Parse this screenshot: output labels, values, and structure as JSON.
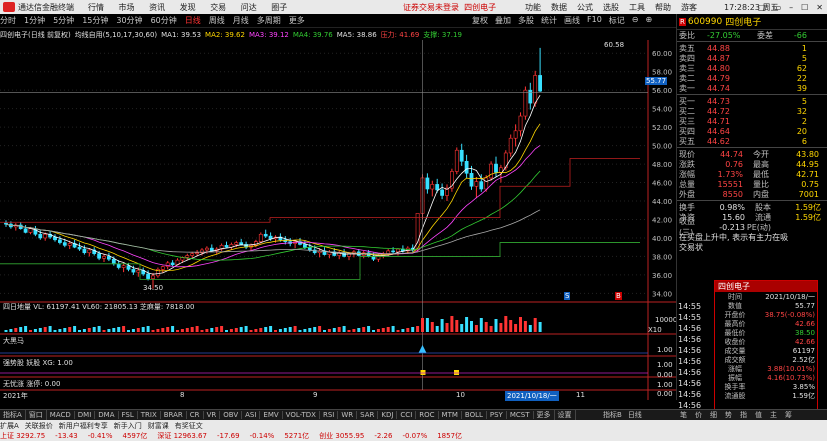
{
  "app": {
    "name": "通达信金融终端",
    "menu": [
      "行情",
      "市场",
      "资讯",
      "发现",
      "交易",
      "问达",
      "圈子"
    ],
    "notice": "证券交易未登录",
    "stock_title": "四创电子",
    "right_menu": [
      "功能",
      "数据",
      "公式",
      "选股",
      "工具",
      "帮助",
      "游客"
    ],
    "time": "17:28:23 周五",
    "window_controls": [
      "□",
      "▭",
      "–",
      "☐",
      "✕"
    ]
  },
  "periods": [
    "分时",
    "1分钟",
    "5分钟",
    "15分钟",
    "30分钟",
    "60分钟",
    "日线",
    "周线",
    "月线",
    "多周期",
    "更多"
  ],
  "active_period": "日线",
  "tools": [
    "复权",
    "叠加",
    "多股",
    "统计",
    "画线",
    "F10",
    "标记",
    "⊖",
    "⊕"
  ],
  "indicator_header": {
    "stock": "四创电子(日线 前复权)",
    "indicator": "均线自用(5,10,17,30,60)",
    "ma1": "MA1: 39.53",
    "ma2": "MA2: 39.62",
    "ma3": "MA3: 39.12",
    "ma4": "MA4: 39.76",
    "ma5": "MA5: 38.86",
    "pressure": "压力: 41.69",
    "support": "支撑: 37.19"
  },
  "price_axis": [
    "60.00",
    "58.00",
    "56.00",
    "54.00",
    "52.00",
    "50.00",
    "48.00",
    "46.00",
    "44.00",
    "42.00",
    "40.00",
    "38.00",
    "36.00",
    "34.00"
  ],
  "chart_labels": {
    "high": "60.58",
    "low": "34.50",
    "cursor_price": "55.77",
    "vol_line": "四日地量 VL: 61197.41 VL60: 21805.13 芝麻量: 7818.00",
    "vol_axis": [
      "10000",
      "X10"
    ],
    "ind2": "大黑马",
    "ind2_axis": "1.00",
    "ind3": "强势股 妖股 XG: 1.00",
    "ind3_axis": [
      "1.00",
      "0.00"
    ],
    "ind4": "无忧涨 涨停: 0.00",
    "ind4_axis": [
      "1.00",
      "0.00"
    ],
    "date_left": "2021年",
    "date_cursor": "2021/10/18/一",
    "month_labels": [
      "8",
      "9",
      "10",
      "11"
    ],
    "mark_s": "S",
    "mark_b": "B"
  },
  "panel": {
    "code": "600990",
    "name": "四创电子",
    "weibi_label": "委比",
    "weibi": "-27.05%",
    "weicha_label": "委差",
    "weicha": "-66",
    "asks": [
      {
        "label": "卖五",
        "price": "44.88",
        "vol": "1"
      },
      {
        "label": "卖四",
        "price": "44.87",
        "vol": "5"
      },
      {
        "label": "卖三",
        "price": "44.80",
        "vol": "62"
      },
      {
        "label": "卖二",
        "price": "44.79",
        "vol": "22"
      },
      {
        "label": "卖一",
        "price": "44.74",
        "vol": "39"
      }
    ],
    "bids": [
      {
        "label": "买一",
        "price": "44.73",
        "vol": "5"
      },
      {
        "label": "买二",
        "price": "44.72",
        "vol": "32"
      },
      {
        "label": "买三",
        "price": "44.71",
        "vol": "2"
      },
      {
        "label": "买四",
        "price": "44.64",
        "vol": "20"
      },
      {
        "label": "买五",
        "price": "44.62",
        "vol": "6"
      }
    ],
    "stats": [
      {
        "l1": "现价",
        "v1": "44.74",
        "l2": "今开",
        "v2": "43.80"
      },
      {
        "l1": "涨跌",
        "v1": "0.76",
        "l2": "最高",
        "v2": "44.95"
      },
      {
        "l1": "涨幅",
        "v1": "1.73%",
        "l2": "最低",
        "v2": "42.71"
      },
      {
        "l1": "总量",
        "v1": "15551",
        "l2": "量比",
        "v2": "0.75"
      },
      {
        "l1": "外盘",
        "v1": "8550",
        "l2": "内盘",
        "v2": "7001"
      }
    ],
    "stats2": [
      {
        "l1": "换手",
        "v1": "0.98%",
        "l2": "股本",
        "v2": "1.59亿"
      },
      {
        "l1": "净资",
        "v1": "15.60",
        "l2": "流通",
        "v2": "1.59亿"
      },
      {
        "l1": "收益(三)",
        "v1": "-0.213",
        "l2": "PE(动)",
        "v2": ""
      }
    ],
    "note1": "在买盘上升中, 表示有主力在吸",
    "note2": "交易状"
  },
  "ticks": [
    "14:55",
    "14:55",
    "14:56",
    "14:56",
    "14:56",
    "14:56",
    "14:56",
    "14:56",
    "14:56",
    "14:56"
  ],
  "popup": {
    "title": "四创电子",
    "rows": [
      {
        "label": "时间",
        "value": "2021/10/18/一"
      },
      {
        "label": "数值",
        "value": "55.77"
      },
      {
        "label": "开盘价",
        "value": "38.75(-0.08%)"
      },
      {
        "label": "最高价",
        "value": "42.66"
      },
      {
        "label": "最低价",
        "value": "38.50"
      },
      {
        "label": "收盘价",
        "value": "42.66"
      },
      {
        "label": "成交量",
        "value": "61197"
      },
      {
        "label": "成交额",
        "value": "2.52亿"
      },
      {
        "label": "涨幅",
        "value": "3.88(10.01%)"
      },
      {
        "label": "振幅",
        "value": "4.16(10.73%)"
      },
      {
        "label": "换手率",
        "value": "3.85%"
      },
      {
        "label": "流通股",
        "value": "1.59亿"
      }
    ]
  },
  "tabs": [
    "指标A",
    "窗口",
    "MACD",
    "DMI",
    "DMA",
    "FSL",
    "TRIX",
    "BRAR",
    "CR",
    "VR",
    "OBV",
    "ASI",
    "EMV",
    "VOL-TDX",
    "RSI",
    "WR",
    "SAR",
    "KDJ",
    "CCI",
    "ROC",
    "MTM",
    "BOLL",
    "PSY",
    "MCST",
    "更多",
    "设置"
  ],
  "tabs_right": [
    "指标B",
    "日线"
  ],
  "right_bottom": [
    "笔",
    "价",
    "细",
    "势",
    "指",
    "值",
    "主",
    "筹"
  ],
  "status": [
    "扩展A",
    "关联报价",
    "新用户福利专享",
    "新手入门",
    "财富课",
    "有奖征文"
  ],
  "ticker": [
    "上证 3292.75",
    "-13.43",
    "-0.41%",
    "4597亿",
    "深证 12963.67",
    "-17.69",
    "-0.14%",
    "5271亿",
    "创业 3055.95",
    "-2.26",
    "-0.07%",
    "1857亿"
  ],
  "chart_data": {
    "type": "candlestick",
    "ylim": [
      33.5,
      61.0
    ],
    "candles": [
      [
        41.6,
        41.9,
        41.2,
        41.5
      ],
      [
        41.5,
        41.8,
        41.0,
        41.2
      ],
      [
        41.2,
        41.6,
        40.8,
        41.4
      ],
      [
        41.4,
        41.7,
        40.9,
        41.0
      ],
      [
        41.0,
        41.4,
        40.5,
        40.6
      ],
      [
        40.6,
        41.2,
        40.4,
        41.0
      ],
      [
        41.0,
        41.3,
        40.2,
        40.4
      ],
      [
        40.4,
        40.8,
        39.8,
        40.0
      ],
      [
        40.0,
        40.6,
        39.7,
        40.4
      ],
      [
        40.4,
        40.7,
        39.9,
        40.1
      ],
      [
        40.1,
        40.4,
        39.6,
        39.8
      ],
      [
        39.8,
        40.2,
        39.3,
        39.5
      ],
      [
        39.5,
        39.9,
        39.0,
        39.2
      ],
      [
        39.2,
        39.7,
        38.8,
        39.4
      ],
      [
        39.4,
        39.8,
        38.9,
        39.0
      ],
      [
        39.0,
        39.5,
        38.6,
        38.8
      ],
      [
        38.8,
        39.2,
        38.2,
        38.4
      ],
      [
        38.4,
        38.9,
        38.0,
        38.7
      ],
      [
        38.7,
        39.0,
        38.1,
        38.3
      ],
      [
        38.3,
        38.6,
        37.6,
        37.8
      ],
      [
        37.8,
        38.3,
        37.4,
        38.0
      ],
      [
        38.0,
        38.4,
        37.5,
        37.7
      ],
      [
        37.7,
        38.0,
        37.0,
        37.2
      ],
      [
        37.2,
        37.6,
        36.6,
        36.8
      ],
      [
        36.8,
        37.3,
        36.3,
        37.0
      ],
      [
        37.0,
        37.3,
        36.4,
        36.6
      ],
      [
        36.6,
        37.0,
        36.0,
        36.3
      ],
      [
        36.3,
        36.8,
        35.8,
        36.5
      ],
      [
        36.5,
        36.8,
        35.9,
        36.1
      ],
      [
        36.1,
        36.5,
        35.4,
        35.6
      ],
      [
        35.6,
        36.2,
        34.5,
        35.9
      ],
      [
        35.9,
        36.8,
        35.7,
        36.6
      ],
      [
        36.6,
        37.0,
        36.2,
        36.9
      ],
      [
        36.9,
        37.5,
        36.6,
        37.3
      ],
      [
        37.3,
        37.6,
        36.9,
        37.1
      ],
      [
        37.1,
        37.8,
        37.0,
        37.6
      ],
      [
        37.6,
        38.0,
        37.3,
        37.9
      ],
      [
        37.9,
        38.3,
        37.6,
        38.1
      ],
      [
        38.1,
        38.5,
        37.8,
        38.3
      ],
      [
        38.3,
        38.7,
        38.0,
        38.4
      ],
      [
        38.4,
        38.9,
        38.1,
        38.7
      ],
      [
        38.7,
        39.1,
        38.3,
        38.9
      ],
      [
        38.9,
        39.3,
        38.5,
        38.6
      ],
      [
        38.6,
        39.0,
        38.2,
        38.8
      ],
      [
        38.8,
        39.4,
        38.6,
        39.2
      ],
      [
        39.2,
        39.6,
        38.9,
        39.0
      ],
      [
        39.0,
        39.5,
        38.7,
        39.3
      ],
      [
        39.3,
        39.7,
        39.0,
        39.5
      ],
      [
        39.5,
        39.9,
        39.2,
        39.3
      ],
      [
        39.3,
        39.6,
        38.8,
        39.0
      ],
      [
        39.0,
        39.4,
        38.6,
        39.2
      ],
      [
        39.2,
        39.8,
        39.0,
        39.6
      ],
      [
        39.6,
        40.6,
        39.4,
        40.4
      ],
      [
        40.4,
        40.9,
        40.0,
        40.2
      ],
      [
        40.2,
        40.6,
        39.7,
        39.9
      ],
      [
        39.9,
        40.3,
        39.5,
        40.1
      ],
      [
        40.1,
        40.5,
        39.6,
        39.8
      ],
      [
        39.8,
        40.2,
        39.3,
        39.6
      ],
      [
        39.6,
        40.0,
        39.1,
        39.4
      ],
      [
        39.4,
        39.8,
        38.9,
        39.6
      ],
      [
        39.6,
        40.0,
        39.2,
        39.3
      ],
      [
        39.3,
        39.7,
        38.8,
        39.0
      ],
      [
        39.0,
        39.4,
        38.5,
        38.7
      ],
      [
        38.7,
        39.2,
        38.2,
        38.4
      ],
      [
        38.4,
        38.9,
        37.9,
        38.6
      ],
      [
        38.6,
        39.0,
        38.1,
        38.2
      ],
      [
        38.2,
        38.7,
        37.8,
        38.5
      ],
      [
        38.5,
        38.9,
        38.0,
        38.1
      ],
      [
        38.1,
        38.6,
        37.7,
        38.4
      ],
      [
        38.4,
        38.8,
        37.9,
        38.0
      ],
      [
        38.0,
        38.5,
        37.6,
        38.3
      ],
      [
        38.3,
        38.7,
        37.9,
        38.5
      ],
      [
        38.5,
        38.8,
        38.0,
        38.1
      ],
      [
        38.1,
        38.6,
        37.8,
        38.4
      ],
      [
        38.4,
        38.7,
        37.9,
        38.0
      ],
      [
        38.0,
        38.4,
        37.5,
        37.7
      ],
      [
        37.7,
        38.3,
        37.4,
        38.1
      ],
      [
        38.1,
        38.5,
        37.8,
        38.3
      ],
      [
        38.3,
        38.8,
        38.0,
        38.6
      ],
      [
        38.6,
        39.0,
        38.3,
        38.5
      ],
      [
        38.5,
        38.9,
        38.1,
        38.8
      ],
      [
        38.8,
        39.2,
        38.4,
        38.6
      ],
      [
        38.6,
        39.1,
        38.3,
        38.9
      ],
      [
        38.9,
        39.3,
        38.5,
        38.7
      ],
      [
        38.7,
        42.66,
        38.5,
        42.66
      ],
      [
        42.66,
        46.9,
        42.0,
        46.5
      ],
      [
        46.5,
        47.0,
        44.8,
        45.3
      ],
      [
        45.3,
        46.2,
        44.5,
        45.8
      ],
      [
        45.8,
        46.4,
        44.9,
        45.2
      ],
      [
        45.2,
        45.9,
        44.2,
        44.6
      ],
      [
        44.6,
        45.8,
        44.0,
        45.4
      ],
      [
        45.4,
        47.5,
        45.0,
        47.2
      ],
      [
        47.2,
        49.8,
        46.9,
        49.5
      ],
      [
        49.5,
        50.2,
        47.8,
        48.3
      ],
      [
        48.3,
        49.0,
        46.5,
        47.0
      ],
      [
        47.0,
        47.8,
        45.2,
        45.6
      ],
      [
        45.6,
        46.6,
        44.3,
        46.1
      ],
      [
        46.1,
        46.9,
        45.0,
        45.3
      ],
      [
        45.3,
        46.8,
        45.0,
        46.5
      ],
      [
        46.5,
        48.3,
        46.2,
        48.0
      ],
      [
        48.0,
        48.8,
        46.6,
        47.1
      ],
      [
        47.1,
        47.9,
        46.0,
        47.6
      ],
      [
        47.6,
        49.5,
        47.3,
        49.2
      ],
      [
        49.2,
        51.2,
        48.8,
        50.8
      ],
      [
        50.8,
        52.3,
        49.9,
        51.6
      ],
      [
        51.6,
        53.6,
        51.0,
        53.2
      ],
      [
        53.2,
        56.4,
        52.8,
        56.0
      ],
      [
        56.0,
        56.8,
        53.9,
        54.6
      ],
      [
        54.6,
        58.1,
        54.2,
        57.6
      ],
      [
        57.6,
        60.58,
        55.8,
        55.9
      ]
    ]
  }
}
